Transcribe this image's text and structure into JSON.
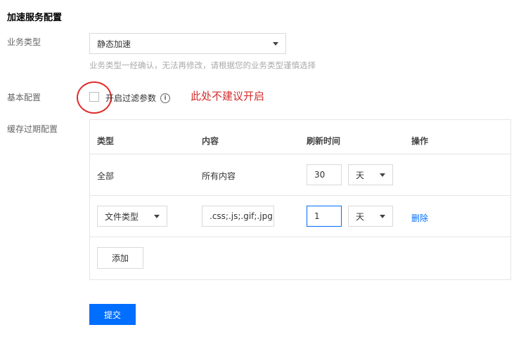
{
  "page": {
    "title": "加速服务配置"
  },
  "business_type": {
    "label": "业务类型",
    "selected": "静态加速",
    "hint": "业务类型一经确认，无法再修改，请根据您的业务类型谨慎选择"
  },
  "basic_config": {
    "label": "基本配置",
    "checkbox_label": "开启过滤参数",
    "checked": false,
    "info_icon": "info-icon",
    "annotation": "此处不建议开启"
  },
  "cache_config": {
    "label": "缓存过期配置",
    "headers": [
      "类型",
      "内容",
      "刷新时间",
      "操作"
    ],
    "rows": [
      {
        "type": "全部",
        "content": "所有内容",
        "time": "30",
        "unit": "天"
      },
      {
        "type": "文件类型",
        "content": ".css;.js;.gif;.jpg;",
        "time": "1",
        "unit": "天",
        "action": "删除"
      }
    ],
    "add_button": "添加"
  },
  "submit_button": "提交",
  "colors": {
    "primary": "#006eff",
    "annotation_red": "#d42c2c",
    "border": "#d9d9d9"
  }
}
